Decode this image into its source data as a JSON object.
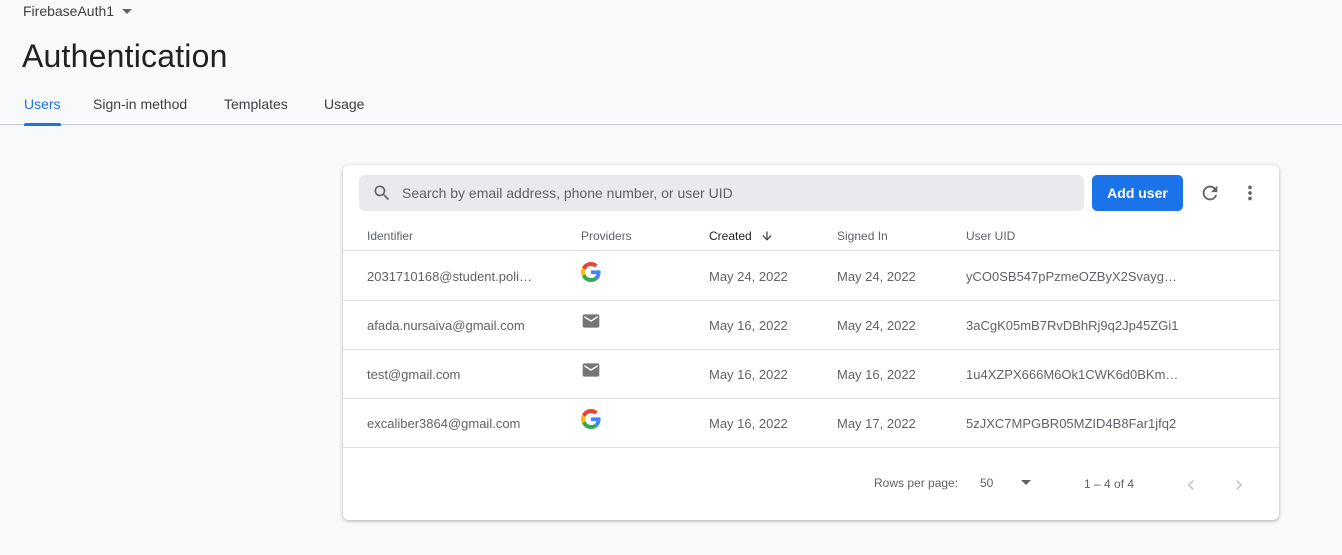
{
  "project": {
    "name": "FirebaseAuth1"
  },
  "page": {
    "title": "Authentication"
  },
  "tabs": [
    {
      "label": "Users",
      "active": true
    },
    {
      "label": "Sign-in method",
      "active": false
    },
    {
      "label": "Templates",
      "active": false
    },
    {
      "label": "Usage",
      "active": false
    }
  ],
  "search": {
    "placeholder": "Search by email address, phone number, or user UID",
    "value": ""
  },
  "toolbar": {
    "add_user_label": "Add user"
  },
  "table": {
    "columns": {
      "identifier": "Identifier",
      "providers": "Providers",
      "created": "Created",
      "signed_in": "Signed In",
      "user_uid": "User UID"
    },
    "rows": [
      {
        "identifier": "2031710168@student.poli…",
        "provider": "google",
        "created": "May 24, 2022",
        "signed_in": "May 24, 2022",
        "uid": "yCO0SB547pPzmeOZByX2Svaygy…"
      },
      {
        "identifier": "afada.nursaiva@gmail.com",
        "provider": "email",
        "created": "May 16, 2022",
        "signed_in": "May 24, 2022",
        "uid": "3aCgK05mB7RvDBhRj9q2Jp45ZGi1"
      },
      {
        "identifier": "test@gmail.com",
        "provider": "email",
        "created": "May 16, 2022",
        "signed_in": "May 16, 2022",
        "uid": "1u4XZPX666M6Ok1CWK6d0BKm…"
      },
      {
        "identifier": "excaliber3864@gmail.com",
        "provider": "google",
        "created": "May 16, 2022",
        "signed_in": "May 17, 2022",
        "uid": "5zJXC7MPGBR05MZID4B8Far1jfq2"
      }
    ]
  },
  "pagination": {
    "rows_per_page_label": "Rows per page:",
    "rows_per_page_value": "50",
    "range_label": "1 – 4 of 4"
  },
  "colors": {
    "accent": "#1a73e8",
    "background": "#f8f9fa",
    "card": "#ffffff",
    "google_blue": "#4285f4",
    "google_red": "#ea4335",
    "google_yellow": "#fbbc05",
    "google_green": "#34a853"
  },
  "icons": {
    "project_caret": "chevron-down-icon",
    "search": "search-icon",
    "refresh": "refresh-icon",
    "more": "more-vert-icon",
    "sort": "arrow-down-icon",
    "provider_google": "google-icon",
    "provider_email": "email-icon",
    "prev_page": "chevron-left-icon",
    "next_page": "chevron-right-icon"
  }
}
